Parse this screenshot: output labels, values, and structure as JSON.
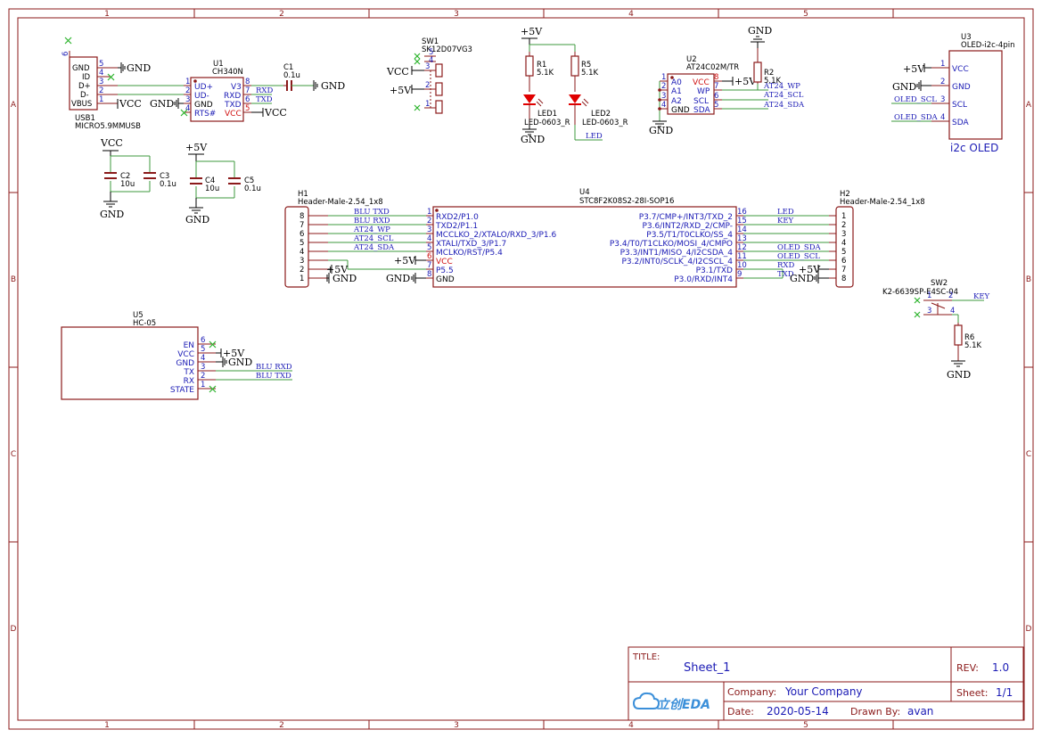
{
  "frame": {
    "cols": [
      "1",
      "2",
      "3",
      "4",
      "5"
    ],
    "rows": [
      "A",
      "B",
      "C",
      "D"
    ]
  },
  "title_block": {
    "title_label": "TITLE:",
    "title": "Sheet_1",
    "rev_label": "REV:",
    "rev": "1.0",
    "company_label": "Company:",
    "company": "Your Company",
    "sheet_label": "Sheet:",
    "sheet": "1/1",
    "date_label": "Date:",
    "date": "2020-05-14",
    "drawn_label": "Drawn By:",
    "drawn_by": "avan",
    "logo": "立创EDA"
  },
  "usb1": {
    "ref": "USB1",
    "value": "MICRO5.9MMUSB",
    "pin6": "6",
    "pins": [
      {
        "name": "GND",
        "num": "5",
        "net": "GND"
      },
      {
        "name": "ID",
        "num": "4",
        "net": ""
      },
      {
        "name": "D+",
        "num": "3",
        "net": ""
      },
      {
        "name": "D-",
        "num": "2",
        "net": ""
      },
      {
        "name": "VBUS",
        "num": "1",
        "net": "VCC"
      }
    ]
  },
  "u1": {
    "ref": "U1",
    "value": "CH340N",
    "left": [
      {
        "name": "UD+",
        "num": "1"
      },
      {
        "name": "UD-",
        "num": "2"
      },
      {
        "name": "GND",
        "num": "3"
      },
      {
        "name": "RTS#",
        "num": "4"
      }
    ],
    "right": [
      {
        "name": "V3",
        "num": "8",
        "net": ""
      },
      {
        "name": "RXD",
        "num": "7",
        "net": "RXD"
      },
      {
        "name": "TXD",
        "num": "6",
        "net": "TXD"
      },
      {
        "name": "VCC",
        "num": "5",
        "net": "VCC"
      }
    ],
    "gnd_label": "GND"
  },
  "c1": {
    "ref": "C1",
    "value": "0.1u",
    "net": "GND"
  },
  "c2": {
    "ref": "C2",
    "value": "10u"
  },
  "c3": {
    "ref": "C3",
    "value": "0.1u"
  },
  "c4": {
    "ref": "C4",
    "value": "10u"
  },
  "c5": {
    "ref": "C5",
    "value": "0.1u"
  },
  "cap_group1": {
    "top": "VCC",
    "bottom": "GND"
  },
  "cap_group2": {
    "top": "+5V",
    "bottom": "GND"
  },
  "sw1": {
    "ref": "SW1",
    "value": "SK12D07VG3",
    "pins": [
      {
        "num": "5",
        "net": ""
      },
      {
        "num": "4",
        "net": ""
      },
      {
        "num": "3",
        "net": "VCC"
      },
      {
        "num": "2",
        "net": "+5V"
      },
      {
        "num": "1",
        "net": ""
      }
    ]
  },
  "leds": {
    "supply": "+5V",
    "r1": {
      "ref": "R1",
      "value": "5.1K"
    },
    "r5": {
      "ref": "R5",
      "value": "5.1K"
    },
    "led1": {
      "ref": "LED1",
      "value": "LED-0603_R"
    },
    "led2": {
      "ref": "LED2",
      "value": "LED-0603_R"
    },
    "gnd": "GND",
    "net": "LED"
  },
  "u2": {
    "ref": "U2",
    "value": "AT24C02M/TR",
    "left": [
      {
        "name": "A0",
        "num": "1"
      },
      {
        "name": "A1",
        "num": "2"
      },
      {
        "name": "A2",
        "num": "3"
      },
      {
        "name": "GND",
        "num": "4"
      }
    ],
    "right": [
      {
        "name": "VCC",
        "num": "8",
        "net": "+5V"
      },
      {
        "name": "WP",
        "num": "7",
        "net": "AT24_WP"
      },
      {
        "name": "SCL",
        "num": "6",
        "net": "AT24_SCL"
      },
      {
        "name": "SDA",
        "num": "5",
        "net": "AT24_SDA"
      }
    ],
    "gnd": "GND",
    "r2": {
      "ref": "R2",
      "value": "5.1K"
    },
    "r2_gnd": "GND"
  },
  "u3": {
    "ref": "U3",
    "value": "OLED-i2c-4pin",
    "caption": "i2c OLED",
    "pins": [
      {
        "name": "VCC",
        "num": "1",
        "net": "+5V"
      },
      {
        "name": "GND",
        "num": "2",
        "net": "GND"
      },
      {
        "name": "SCL",
        "num": "3",
        "net": "OLED_SCL"
      },
      {
        "name": "SDA",
        "num": "4",
        "net": "OLED_SDA"
      }
    ]
  },
  "h1": {
    "ref": "H1",
    "value": "Header-Male-2.54_1x8",
    "pins": [
      "8",
      "7",
      "6",
      "5",
      "4",
      "3",
      "2",
      "1"
    ],
    "vcc": "+5V",
    "gnd": "GND"
  },
  "u4": {
    "ref": "U4",
    "value": "STC8F2K08S2-28I-SOP16",
    "left": [
      {
        "name": "RXD2/P1.0",
        "num": "1",
        "net": "BLU TXD"
      },
      {
        "name": "TXD2/P1.1",
        "num": "2",
        "net": "BLU RXD"
      },
      {
        "name": "MCCLKO_2/XTALO/RXD_3/P1.6",
        "num": "3",
        "net": "AT24_WP"
      },
      {
        "name": "XTALI/TXD_3/P1.7",
        "num": "4",
        "net": "AT24_SCL"
      },
      {
        "name": "MCLKO/RST/P5.4",
        "num": "5",
        "net": "AT24_SDA"
      },
      {
        "name": "VCC",
        "num": "6",
        "net": "+5V"
      },
      {
        "name": "P5.5",
        "num": "7",
        "net": ""
      },
      {
        "name": "GND",
        "num": "8",
        "net": "GND"
      }
    ],
    "right": [
      {
        "name": "P3.7/CMP+/INT3/TXD_2",
        "num": "16",
        "net": "LED"
      },
      {
        "name": "P3.6/INT2/RXD_2/CMP-",
        "num": "15",
        "net": "KEY"
      },
      {
        "name": "P3.5/T1/T0CLKO/SS_4",
        "num": "14",
        "net": ""
      },
      {
        "name": "P3.4/T0/T1CLKO/MOSI_4/CMPO",
        "num": "13",
        "net": ""
      },
      {
        "name": "P3.3/INT1/MISO_4/I2CSDA_4",
        "num": "12",
        "net": "OLED_SDA"
      },
      {
        "name": "P3.2/INT0/SCLK_4/I2CSCL_4",
        "num": "11",
        "net": "OLED_SCL"
      },
      {
        "name": "P3.1/TXD",
        "num": "10",
        "net": "RXD"
      },
      {
        "name": "P3.0/RXD/INT4",
        "num": "9",
        "net": "TXD"
      }
    ]
  },
  "h2": {
    "ref": "H2",
    "value": "Header-Male-2.54_1x8",
    "pins": [
      "1",
      "2",
      "3",
      "4",
      "5",
      "6",
      "7",
      "8"
    ],
    "vcc": "+5V",
    "gnd": "GND"
  },
  "sw2": {
    "ref": "SW2",
    "value": "K2-6639SP-E4SC-04",
    "pins": [
      "1",
      "2",
      "3",
      "4"
    ],
    "net": "KEY",
    "r6": {
      "ref": "R6",
      "value": "5.1K"
    },
    "gnd": "GND"
  },
  "u5": {
    "ref": "U5",
    "value": "HC-05",
    "pins": [
      {
        "name": "EN",
        "num": "6",
        "net": ""
      },
      {
        "name": "VCC",
        "num": "5",
        "net": "+5V"
      },
      {
        "name": "GND",
        "num": "4",
        "net": "GND"
      },
      {
        "name": "TX",
        "num": "3",
        "net": "BLU RXD"
      },
      {
        "name": "RX",
        "num": "2",
        "net": "BLU TXD"
      },
      {
        "name": "STATE",
        "num": "1",
        "net": ""
      }
    ]
  }
}
